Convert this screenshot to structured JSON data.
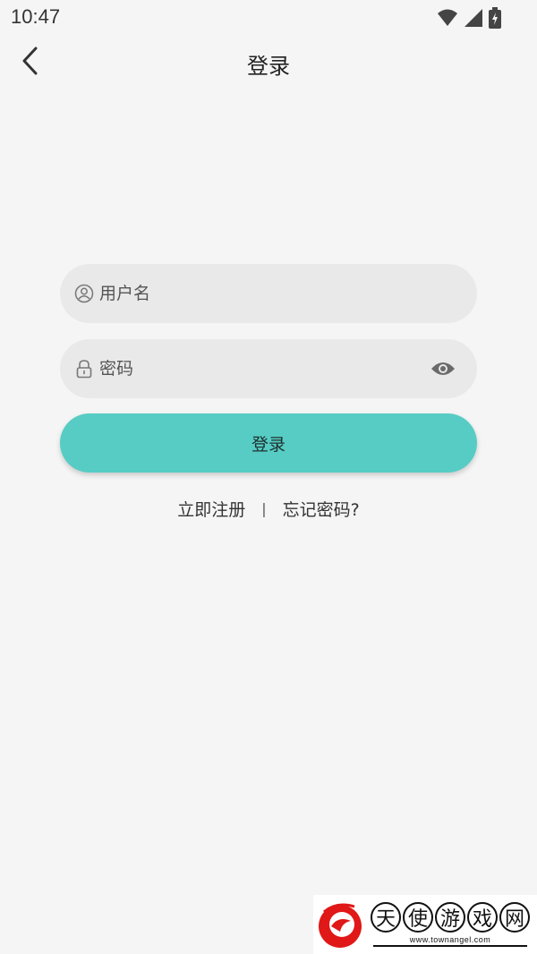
{
  "status_bar": {
    "time": "10:47",
    "icons": [
      "wifi-icon",
      "signal-icon",
      "battery-charging-icon"
    ]
  },
  "header": {
    "title": "登录",
    "back_icon": "chevron-left-icon"
  },
  "form": {
    "username_placeholder": "用户名",
    "username_value": "",
    "password_placeholder": "密码",
    "password_value": "",
    "login_label": "登录"
  },
  "links": {
    "register": "立即注册",
    "separator": "|",
    "forgot": "忘记密码?"
  },
  "watermark": {
    "chars": [
      "天",
      "使",
      "游",
      "戏",
      "网"
    ],
    "url": "www.townangel.com"
  },
  "colors": {
    "background": "#f5f5f5",
    "field_background": "#e9e9e9",
    "accent": "#56ccc4"
  }
}
